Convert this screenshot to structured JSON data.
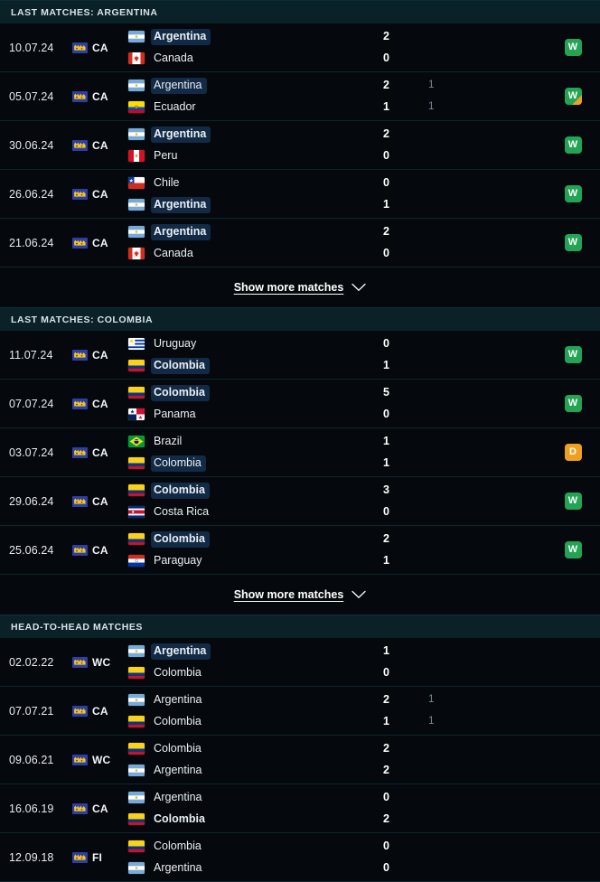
{
  "colors": {
    "page_bg": "#05090d",
    "section_header_bg": "#0a2128",
    "row_divider": "#0d262c",
    "win_badge": "#23a455",
    "draw_badge": "#f0a020",
    "highlight_pill": "#122a45",
    "secondary_score": "#7b8893"
  },
  "sections": [
    {
      "id": "last-matches-argentina",
      "header": "LAST MATCHES: ARGENTINA",
      "matches": [
        {
          "date": "10.07.24",
          "competition": {
            "code": "CA",
            "icon": "copa-america-icon"
          },
          "home": {
            "name": "Argentina",
            "flag": "argentina",
            "bold": true,
            "highlight": true
          },
          "away": {
            "name": "Canada",
            "flag": "canada",
            "bold": false,
            "highlight": false
          },
          "score_home": "2",
          "score_away": "0",
          "sub_home": "",
          "sub_away": "",
          "result": "W",
          "result_type": "win",
          "penalty": false
        },
        {
          "date": "05.07.24",
          "competition": {
            "code": "CA",
            "icon": "copa-america-icon"
          },
          "home": {
            "name": "Argentina",
            "flag": "argentina",
            "bold": false,
            "highlight": true
          },
          "away": {
            "name": "Ecuador",
            "flag": "ecuador",
            "bold": false,
            "highlight": false
          },
          "score_home": "2",
          "score_away": "1",
          "sub_home": "1",
          "sub_away": "1",
          "result": "W",
          "result_type": "win",
          "penalty": true
        },
        {
          "date": "30.06.24",
          "competition": {
            "code": "CA",
            "icon": "copa-america-icon"
          },
          "home": {
            "name": "Argentina",
            "flag": "argentina",
            "bold": true,
            "highlight": true
          },
          "away": {
            "name": "Peru",
            "flag": "peru",
            "bold": false,
            "highlight": false
          },
          "score_home": "2",
          "score_away": "0",
          "sub_home": "",
          "sub_away": "",
          "result": "W",
          "result_type": "win",
          "penalty": false
        },
        {
          "date": "26.06.24",
          "competition": {
            "code": "CA",
            "icon": "copa-america-icon"
          },
          "home": {
            "name": "Chile",
            "flag": "chile",
            "bold": false,
            "highlight": false
          },
          "away": {
            "name": "Argentina",
            "flag": "argentina",
            "bold": true,
            "highlight": true
          },
          "score_home": "0",
          "score_away": "1",
          "sub_home": "",
          "sub_away": "",
          "result": "W",
          "result_type": "win",
          "penalty": false
        },
        {
          "date": "21.06.24",
          "competition": {
            "code": "CA",
            "icon": "copa-america-icon"
          },
          "home": {
            "name": "Argentina",
            "flag": "argentina",
            "bold": true,
            "highlight": true
          },
          "away": {
            "name": "Canada",
            "flag": "canada",
            "bold": false,
            "highlight": false
          },
          "score_home": "2",
          "score_away": "0",
          "sub_home": "",
          "sub_away": "",
          "result": "W",
          "result_type": "win",
          "penalty": false
        }
      ],
      "show_more": {
        "label": "Show more matches",
        "icon": "chevron-down-icon"
      }
    },
    {
      "id": "last-matches-colombia",
      "header": "LAST MATCHES: COLOMBIA",
      "matches": [
        {
          "date": "11.07.24",
          "competition": {
            "code": "CA",
            "icon": "copa-america-icon"
          },
          "home": {
            "name": "Uruguay",
            "flag": "uruguay",
            "bold": false,
            "highlight": false
          },
          "away": {
            "name": "Colombia",
            "flag": "colombia",
            "bold": true,
            "highlight": true
          },
          "score_home": "0",
          "score_away": "1",
          "sub_home": "",
          "sub_away": "",
          "result": "W",
          "result_type": "win",
          "penalty": false
        },
        {
          "date": "07.07.24",
          "competition": {
            "code": "CA",
            "icon": "copa-america-icon"
          },
          "home": {
            "name": "Colombia",
            "flag": "colombia",
            "bold": true,
            "highlight": true
          },
          "away": {
            "name": "Panama",
            "flag": "panama",
            "bold": false,
            "highlight": false
          },
          "score_home": "5",
          "score_away": "0",
          "sub_home": "",
          "sub_away": "",
          "result": "W",
          "result_type": "win",
          "penalty": false
        },
        {
          "date": "03.07.24",
          "competition": {
            "code": "CA",
            "icon": "copa-america-icon"
          },
          "home": {
            "name": "Brazil",
            "flag": "brazil",
            "bold": false,
            "highlight": false
          },
          "away": {
            "name": "Colombia",
            "flag": "colombia",
            "bold": false,
            "highlight": true
          },
          "score_home": "1",
          "score_away": "1",
          "sub_home": "",
          "sub_away": "",
          "result": "D",
          "result_type": "draw",
          "penalty": false
        },
        {
          "date": "29.06.24",
          "competition": {
            "code": "CA",
            "icon": "copa-america-icon"
          },
          "home": {
            "name": "Colombia",
            "flag": "colombia",
            "bold": true,
            "highlight": true
          },
          "away": {
            "name": "Costa Rica",
            "flag": "costarica",
            "bold": false,
            "highlight": false
          },
          "score_home": "3",
          "score_away": "0",
          "sub_home": "",
          "sub_away": "",
          "result": "W",
          "result_type": "win",
          "penalty": false
        },
        {
          "date": "25.06.24",
          "competition": {
            "code": "CA",
            "icon": "copa-america-icon"
          },
          "home": {
            "name": "Colombia",
            "flag": "colombia",
            "bold": true,
            "highlight": true
          },
          "away": {
            "name": "Paraguay",
            "flag": "paraguay",
            "bold": false,
            "highlight": false
          },
          "score_home": "2",
          "score_away": "1",
          "sub_home": "",
          "sub_away": "",
          "result": "W",
          "result_type": "win",
          "penalty": false
        }
      ],
      "show_more": {
        "label": "Show more matches",
        "icon": "chevron-down-icon"
      }
    },
    {
      "id": "head-to-head-matches",
      "header": "HEAD-TO-HEAD MATCHES",
      "matches": [
        {
          "date": "02.02.22",
          "competition": {
            "code": "WC",
            "icon": "world-cup-icon"
          },
          "home": {
            "name": "Argentina",
            "flag": "argentina",
            "bold": true,
            "highlight": true
          },
          "away": {
            "name": "Colombia",
            "flag": "colombia",
            "bold": false,
            "highlight": false
          },
          "score_home": "1",
          "score_away": "0",
          "sub_home": "",
          "sub_away": "",
          "result": "",
          "result_type": "none",
          "penalty": false
        },
        {
          "date": "07.07.21",
          "competition": {
            "code": "CA",
            "icon": "copa-america-icon"
          },
          "home": {
            "name": "Argentina",
            "flag": "argentina",
            "bold": false,
            "highlight": false
          },
          "away": {
            "name": "Colombia",
            "flag": "colombia",
            "bold": false,
            "highlight": false
          },
          "score_home": "2",
          "score_away": "1",
          "sub_home": "1",
          "sub_away": "1",
          "result": "",
          "result_type": "none",
          "penalty": false
        },
        {
          "date": "09.06.21",
          "competition": {
            "code": "WC",
            "icon": "world-cup-icon"
          },
          "home": {
            "name": "Colombia",
            "flag": "colombia",
            "bold": false,
            "highlight": false
          },
          "away": {
            "name": "Argentina",
            "flag": "argentina",
            "bold": false,
            "highlight": false
          },
          "score_home": "2",
          "score_away": "2",
          "sub_home": "",
          "sub_away": "",
          "result": "",
          "result_type": "none",
          "penalty": false
        },
        {
          "date": "16.06.19",
          "competition": {
            "code": "CA",
            "icon": "copa-america-icon"
          },
          "home": {
            "name": "Argentina",
            "flag": "argentina",
            "bold": false,
            "highlight": false
          },
          "away": {
            "name": "Colombia",
            "flag": "colombia",
            "bold": true,
            "highlight": false
          },
          "score_home": "0",
          "score_away": "2",
          "sub_home": "",
          "sub_away": "",
          "result": "",
          "result_type": "none",
          "penalty": false
        },
        {
          "date": "12.09.18",
          "competition": {
            "code": "FI",
            "icon": "friendly-icon"
          },
          "home": {
            "name": "Colombia",
            "flag": "colombia",
            "bold": false,
            "highlight": false
          },
          "away": {
            "name": "Argentina",
            "flag": "argentina",
            "bold": false,
            "highlight": false
          },
          "score_home": "0",
          "score_away": "0",
          "sub_home": "",
          "sub_away": "",
          "result": "",
          "result_type": "none",
          "penalty": false
        }
      ],
      "show_more": null
    }
  ]
}
